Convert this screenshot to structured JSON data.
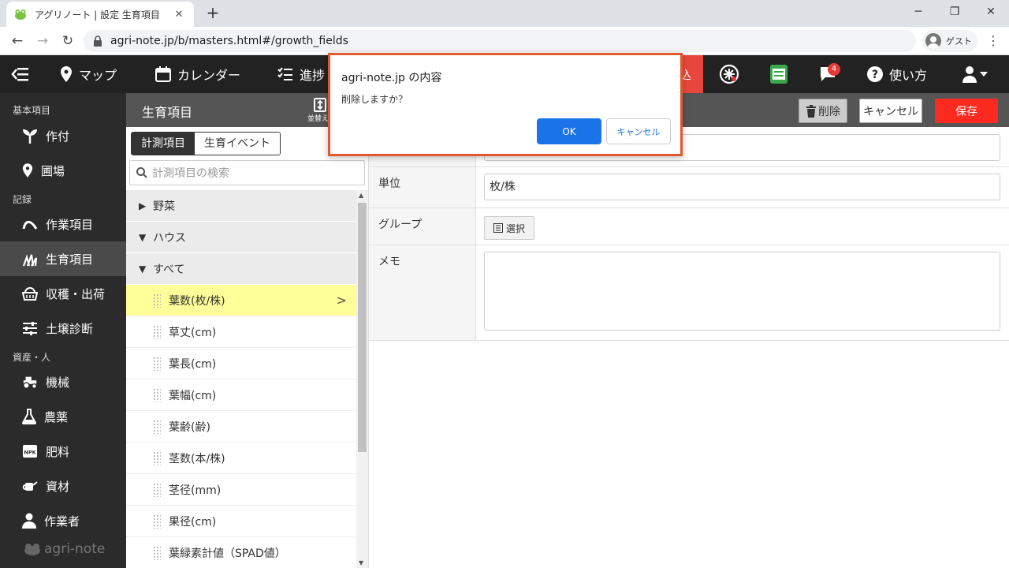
{
  "browser": {
    "tab_title": "アグリノート | 設定 生育項目",
    "url": "agri-note.jp/b/masters.html#/growth_fields",
    "guest_label": "ゲスト"
  },
  "topnav": {
    "items": [
      {
        "label": "マップ"
      },
      {
        "label": "カレンダー"
      },
      {
        "label": "進捗"
      }
    ],
    "red_item_partial": "込",
    "chat_badge": "4",
    "help_label": "使い方"
  },
  "sidebar": {
    "section_basic": "基本項目",
    "section_record": "記録",
    "section_assets": "資産・人",
    "items": [
      {
        "label": "作付"
      },
      {
        "label": "圃場"
      },
      {
        "label": "作業項目"
      },
      {
        "label": "生育項目"
      },
      {
        "label": "収穫・出荷"
      },
      {
        "label": "土壌診断"
      },
      {
        "label": "機械"
      },
      {
        "label": "農薬"
      },
      {
        "label": "肥料"
      },
      {
        "label": "資材"
      },
      {
        "label": "作業者"
      }
    ],
    "logo_text": "agri-note",
    "npk_text": "NPK"
  },
  "header": {
    "title": "生育項目",
    "sort_label": "並替え",
    "delete_label": "削除",
    "cancel_label": "キャンセル",
    "save_label": "保存"
  },
  "list": {
    "tab_measure": "計測項目",
    "tab_event": "生育イベント",
    "search_placeholder": "計測項目の検索",
    "groups": [
      {
        "label": "野菜",
        "expanded": false
      },
      {
        "label": "ハウス",
        "expanded": true
      },
      {
        "label": "すべて",
        "expanded": true
      }
    ],
    "items": [
      {
        "label": "葉数(枚/株)",
        "selected": true
      },
      {
        "label": "草丈(cm)"
      },
      {
        "label": "葉長(cm)"
      },
      {
        "label": "葉幅(cm)"
      },
      {
        "label": "葉齢(齢)"
      },
      {
        "label": "茎数(本/株)"
      },
      {
        "label": "茎径(mm)"
      },
      {
        "label": "果径(cm)"
      },
      {
        "label": "葉緑素計値（SPAD値）"
      }
    ]
  },
  "form": {
    "unit_label": "単位",
    "unit_value": "枚/株",
    "group_label": "グループ",
    "select_label": "選択",
    "memo_label": "メモ"
  },
  "dialog": {
    "title": "agri-note.jp の内容",
    "message": "削除しますか？",
    "ok": "OK",
    "cancel": "キャンセル"
  },
  "colors": {
    "accent_red": "#ff2a1f",
    "selected_row": "#ffff99",
    "dialog_border": "#e05a2e",
    "ok_blue": "#1a73e8"
  }
}
